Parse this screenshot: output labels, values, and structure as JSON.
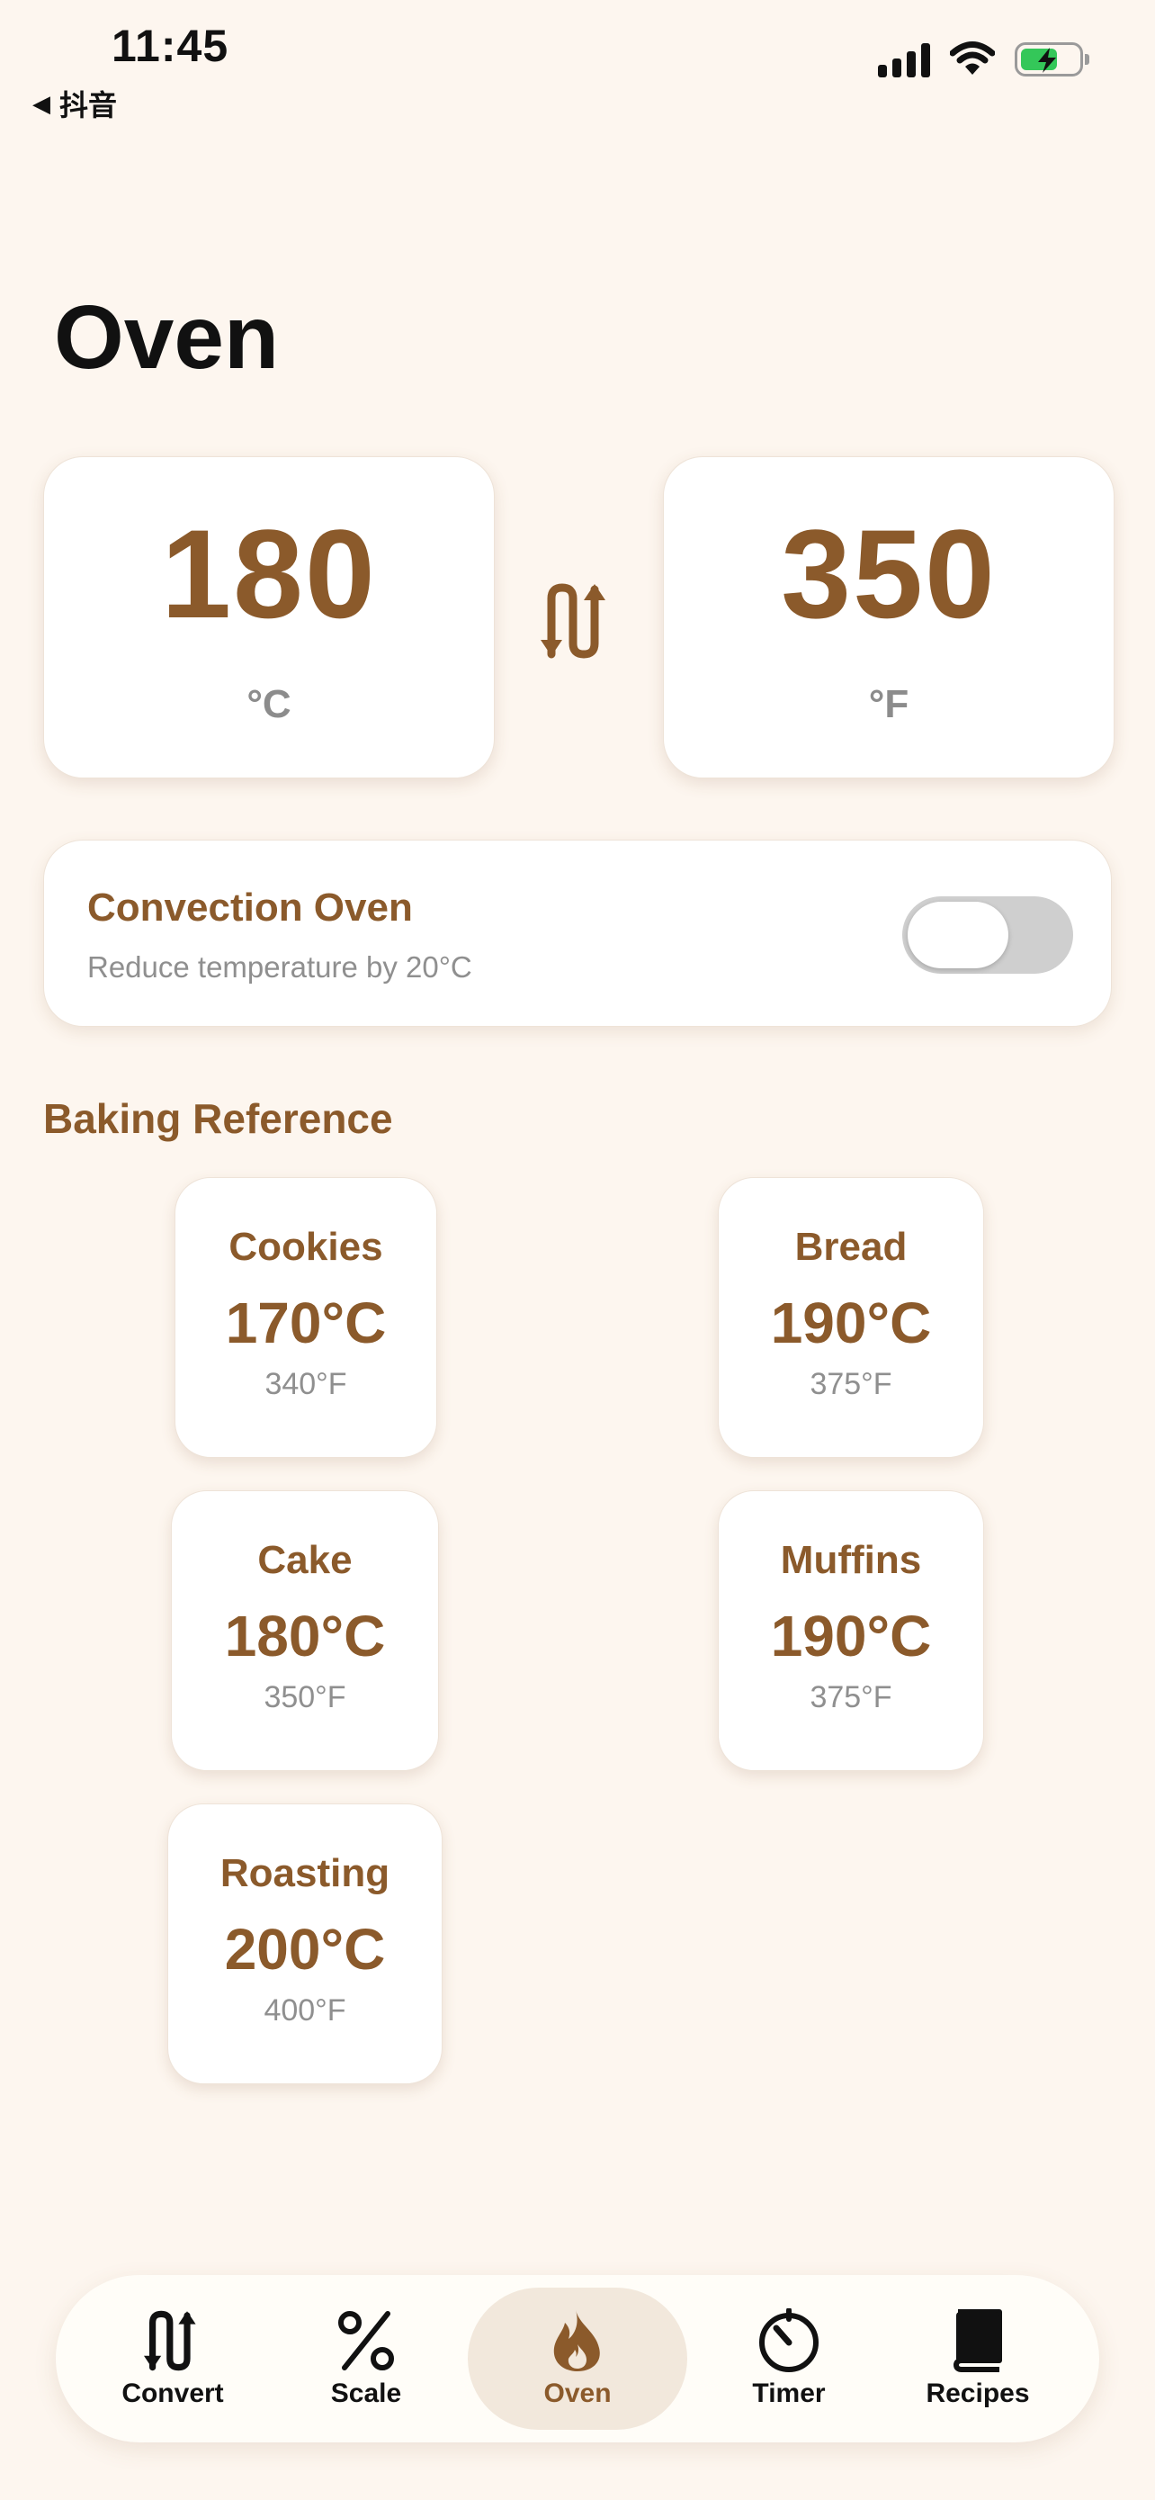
{
  "status_bar": {
    "time": "11:45",
    "back_label": "抖音"
  },
  "page": {
    "title": "Oven"
  },
  "converter": {
    "celsius_value": "180",
    "celsius_unit": "°C",
    "fahrenheit_value": "350",
    "fahrenheit_unit": "°F"
  },
  "convection": {
    "title": "Convection Oven",
    "subtitle": "Reduce temperature by 20°C",
    "enabled": false
  },
  "reference": {
    "title": "Baking Reference",
    "items": [
      {
        "name": "Cookies",
        "celsius": "170°C",
        "fahrenheit": "340°F"
      },
      {
        "name": "Bread",
        "celsius": "190°C",
        "fahrenheit": "375°F"
      },
      {
        "name": "Cake",
        "celsius": "180°C",
        "fahrenheit": "350°F"
      },
      {
        "name": "Muffins",
        "celsius": "190°C",
        "fahrenheit": "375°F"
      },
      {
        "name": "Roasting",
        "celsius": "200°C",
        "fahrenheit": "400°F"
      }
    ]
  },
  "tabs": [
    {
      "label": "Convert",
      "icon": "convert-arrows-icon"
    },
    {
      "label": "Scale",
      "icon": "percent-icon"
    },
    {
      "label": "Oven",
      "icon": "flame-icon",
      "active": true
    },
    {
      "label": "Timer",
      "icon": "timer-icon"
    },
    {
      "label": "Recipes",
      "icon": "book-icon"
    }
  ],
  "colors": {
    "accent": "#8b5a2b",
    "background": "#fdf6ef",
    "toggle_off": "#cfcfcf",
    "battery": "#34c759"
  }
}
